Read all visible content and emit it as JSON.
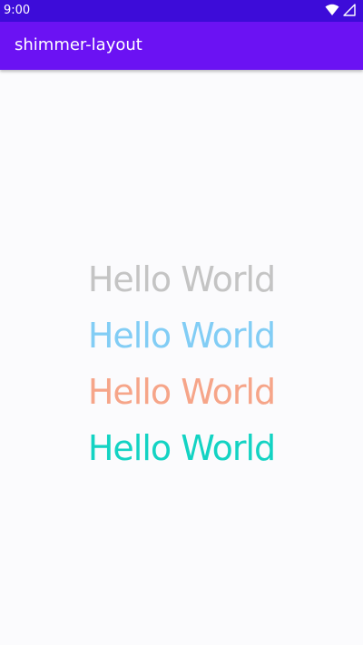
{
  "status_bar": {
    "time": "9:00",
    "icons": [
      "wifi-icon",
      "signal-icon"
    ],
    "background": "#3d0cd9"
  },
  "app_bar": {
    "title": "shimmer-layout",
    "background": "#6b12f3"
  },
  "texts": [
    {
      "label": "Hello World",
      "color": "#c4c4c4"
    },
    {
      "label": "Hello World",
      "color": "#82cdf5"
    },
    {
      "label": "Hello World",
      "color": "#f6a589"
    },
    {
      "label": "Hello World",
      "color": "#13d3c3"
    }
  ]
}
